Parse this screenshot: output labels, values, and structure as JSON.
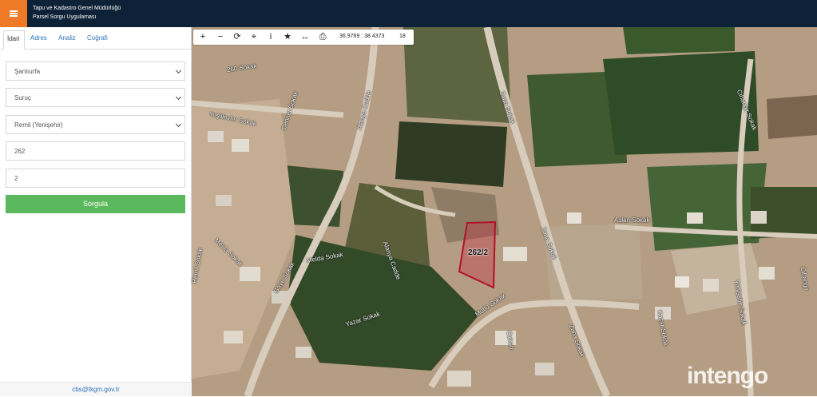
{
  "header": {
    "title_line1": "Tapu ve Kadastro Genel Müdürlüğü",
    "title_line2": "Parsel Sorgu Uygulaması",
    "accent_color": "#ee7a27",
    "bar_color": "#0d2237"
  },
  "sidebar": {
    "tabs": [
      {
        "label": "İdari",
        "active": true
      },
      {
        "label": "Adres",
        "active": false
      },
      {
        "label": "Analiz",
        "active": false
      },
      {
        "label": "Coğrafi",
        "active": false
      }
    ],
    "province": "Şanlıurfa",
    "district": "Suruç",
    "neighborhood": "Remil (Yenişehir)",
    "block": "262",
    "parcel": "2",
    "query_label": "Sorgula",
    "footer_email": "cbs@tkgm.gov.tr"
  },
  "map": {
    "toolbar": {
      "icons": [
        "zoom-in-icon",
        "zoom-out-icon",
        "refresh-icon",
        "locate-icon",
        "info-icon",
        "bookmark-icon",
        "measure-icon",
        "print-icon"
      ],
      "coordinates": "36.9769 : 38.4373",
      "zoom_level": "18"
    },
    "parcel_label": "262/2",
    "streets": [
      "260 Sokak",
      "Yeşillevler Sokak",
      "Cennet Sokak",
      "Alanya Cadde",
      "Zana Sokak",
      "Cihangir Sokak",
      "Aslan Sokak",
      "Zana Sokak",
      "Melda Sokak",
      "Melda Sokak",
      "Alanya Cadde",
      "Yazar Sokak",
      "Mutlu Sokak",
      "Zana Sokak",
      "Kaçar Sokak",
      "Yenişehir Sokak",
      "Cihangir",
      "Gaye Sokak",
      "Özkan",
      "Remil Sokak"
    ],
    "watermark": "intengo"
  }
}
